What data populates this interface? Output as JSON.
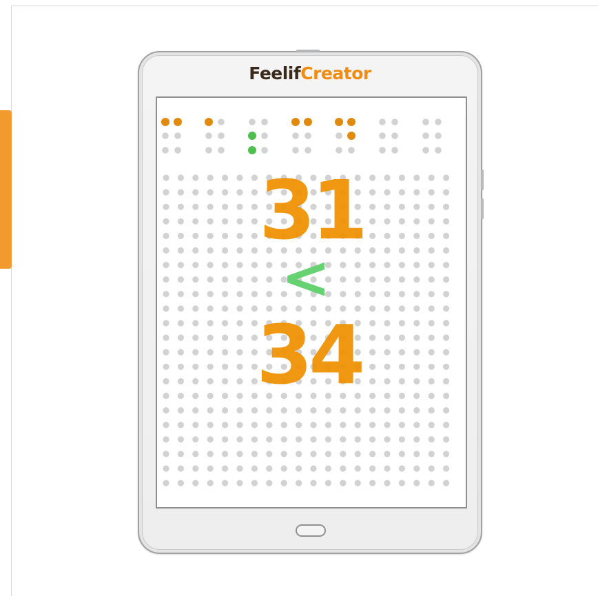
{
  "brand": {
    "part1": "Feelif",
    "part2": "Creator"
  },
  "display": {
    "number_a": "31",
    "comparison": "<",
    "number_b": "34"
  },
  "icons": [
    "home-button"
  ],
  "colors": {
    "accent": "#f39a2e",
    "brand_dark": "#3a2a1c",
    "brand_orange": "#f08c12",
    "number": "#f09000",
    "comparison": "#5fd06a",
    "dot_inactive": "#d2d2d2",
    "braille_active_orange": "#e08a10",
    "braille_active_green": "#4fbf4f"
  },
  "braille_cells": [
    {
      "dots": [
        1,
        4
      ],
      "color": "orange"
    },
    {
      "dots": [
        1
      ],
      "color": "orange"
    },
    {
      "dots": [
        2,
        3
      ],
      "color": "green"
    },
    {
      "dots": [
        1,
        4
      ],
      "color": "orange"
    },
    {
      "dots": [
        1,
        4,
        5
      ],
      "color": "orange"
    },
    {
      "dots": [],
      "color": "none"
    },
    {
      "dots": [],
      "color": "none"
    }
  ]
}
